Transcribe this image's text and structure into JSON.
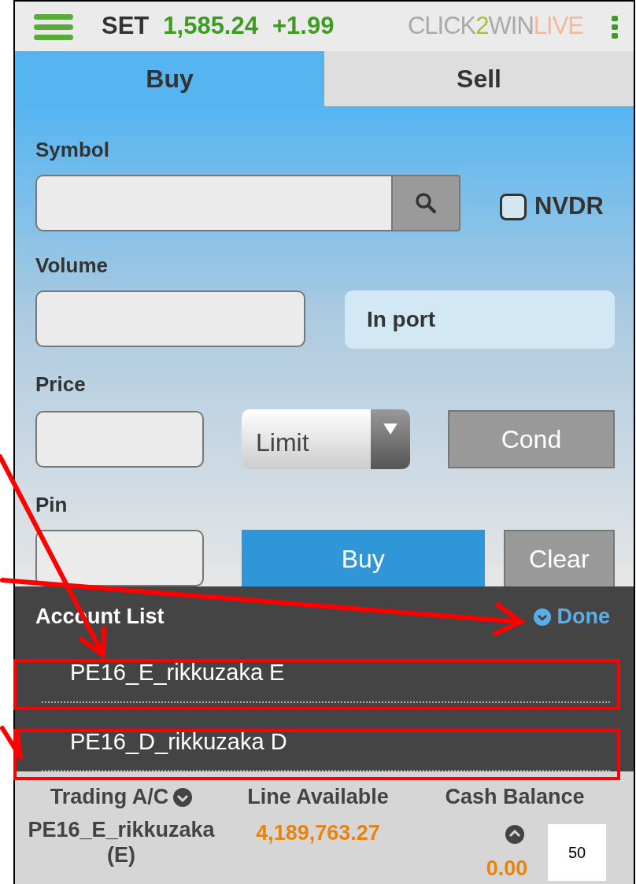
{
  "header": {
    "index_name": "SET",
    "index_value": "1,585.24",
    "index_change": "+1.99",
    "logo": [
      "CLICK",
      "2",
      "WIN",
      "LIVE"
    ]
  },
  "tabs": [
    {
      "label": "Buy",
      "selected": true
    },
    {
      "label": "Sell",
      "selected": false
    }
  ],
  "form": {
    "symbol_label": "Symbol",
    "nvdr": {
      "label": "NVDR",
      "checked": false
    },
    "volume_label": "Volume",
    "in_port_button": "In port",
    "price_label": "Price",
    "order_type": "Limit",
    "cond_button": "Cond",
    "pin_label": "Pin",
    "buy_button": "Buy",
    "clear_button": "Clear"
  },
  "account_list": {
    "title": "Account List",
    "done": "Done",
    "items": [
      {
        "label": "PE16_E_rikkuzaka E"
      },
      {
        "label": "PE16_D_rikkuzaka D"
      }
    ]
  },
  "footer": {
    "trading_label": "Trading A/C",
    "trading_value": "PE16_E_rikkuzaka (E)",
    "line_label": "Line Available",
    "line_value": "4,189,763.27",
    "cash_label": "Cash Balance",
    "cash_value": "0.00"
  },
  "page_number": "50"
}
